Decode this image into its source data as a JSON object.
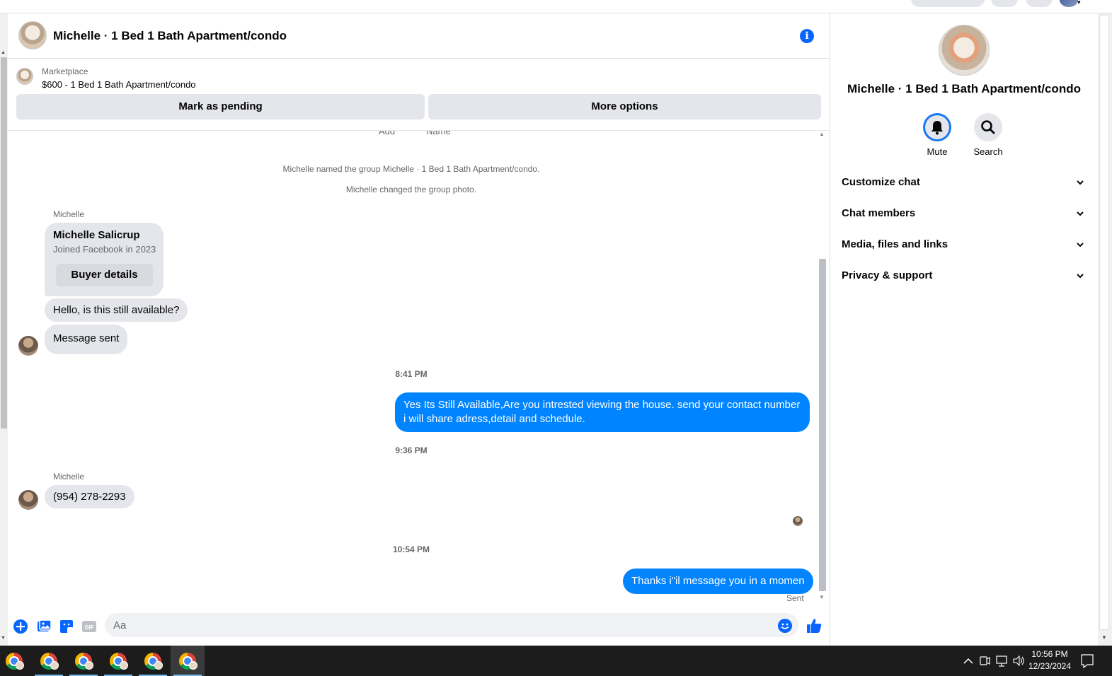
{
  "header": {
    "title": "Michelle · 1 Bed 1 Bath Apartment/condo"
  },
  "marketplace": {
    "label": "Marketplace",
    "item": "$600 - 1 Bed 1 Bath Apartment/condo",
    "mark_pending": "Mark as pending",
    "more_options": "More options"
  },
  "messages": {
    "cutoff_left": "Add",
    "cutoff_right": "Name",
    "system": [
      "Michelle named the group Michelle · 1 Bed 1 Bath Apartment/condo.",
      "Michelle changed the group photo."
    ],
    "sender1": "Michelle",
    "card_name": "Michelle Salicrup",
    "card_sub": "Joined Facebook in 2023",
    "card_button": "Buyer details",
    "in1": "Hello, is this still available?",
    "in2": "Message sent",
    "ts1": "8:41 PM",
    "out1": "Yes Its Still Available,Are you intrested viewing the house. send your contact number i will share adress,detail and schedule.",
    "ts2": "9:36 PM",
    "sender2": "Michelle",
    "in3": "(954) 278-2293",
    "ts3": "10:54 PM",
    "out2": "Thanks i\"il message you in a momen",
    "sent": "Sent"
  },
  "composer": {
    "placeholder": "Aa"
  },
  "info_panel": {
    "title": "Michelle · 1 Bed 1 Bath Apartment/condo",
    "mute": "Mute",
    "search": "Search",
    "sections": [
      "Customize chat",
      "Chat members",
      "Media, files and links",
      "Privacy & support"
    ]
  },
  "taskbar": {
    "time": "10:56 PM",
    "date": "12/23/2024"
  },
  "colors": {
    "accent": "#0866ff",
    "bubble_out": "#0084ff",
    "bubble_in": "#e4e6eb"
  }
}
